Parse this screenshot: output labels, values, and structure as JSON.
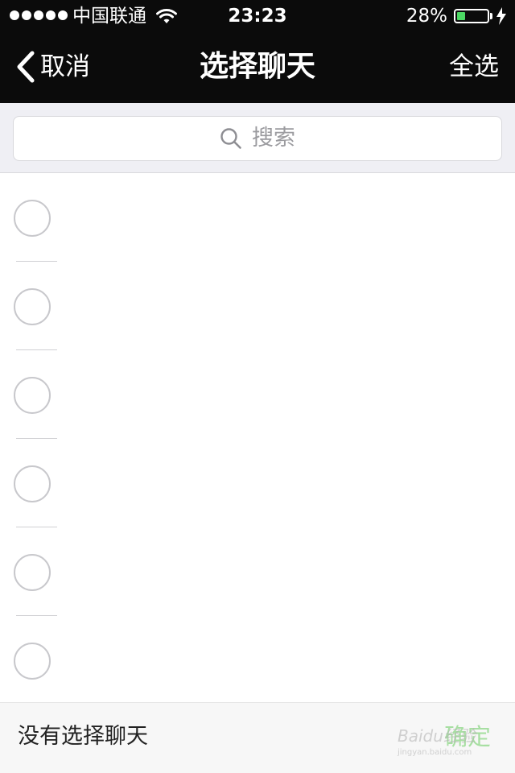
{
  "status_bar": {
    "carrier": "中国联通",
    "time": "23:23",
    "battery_percent": "28%",
    "battery_level": 0.28,
    "signal_bars": 5,
    "icons": [
      "signal-dots-icon",
      "wifi-icon",
      "battery-icon",
      "charging-bolt-icon"
    ]
  },
  "nav": {
    "back_label": "取消",
    "title": "选择聊天",
    "right_action": "全选",
    "back_icon": "chevron-left-icon"
  },
  "search": {
    "placeholder": "搜索",
    "icon": "search-icon"
  },
  "chat_list": {
    "rows": [
      {
        "selected": false
      },
      {
        "selected": false
      },
      {
        "selected": false
      },
      {
        "selected": false
      },
      {
        "selected": false
      },
      {
        "selected": false
      }
    ]
  },
  "bottom_bar": {
    "status_text": "没有选择聊天",
    "confirm_label": "确定"
  },
  "watermark": {
    "main": "Baidu经验",
    "sub": "jingyan.baidu.com"
  },
  "colors": {
    "nav_background": "#0b0b0b",
    "search_area_background": "#efeff4",
    "battery_fill": "#4cd964",
    "confirm_disabled": "#a7dfa2",
    "radio_border": "#c8c8cc"
  }
}
